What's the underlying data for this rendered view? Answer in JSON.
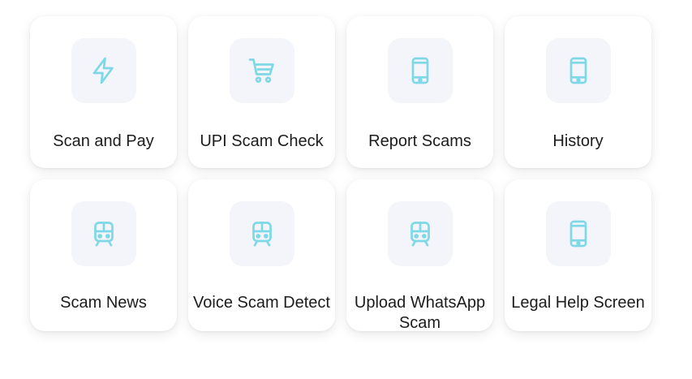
{
  "accent_color": "#7fd8e6",
  "tile_background": "#f4f5fb",
  "cards": [
    {
      "label": "Scan and Pay",
      "icon": "lightning-icon"
    },
    {
      "label": "UPI Scam Check",
      "icon": "shopping-cart-icon"
    },
    {
      "label": "Report Scams",
      "icon": "smartphone-icon"
    },
    {
      "label": "History",
      "icon": "smartphone-icon"
    },
    {
      "label": "Scam News",
      "icon": "train-icon"
    },
    {
      "label": "Voice Scam Detect",
      "icon": "train-icon"
    },
    {
      "label": "Upload WhatsApp Scam",
      "icon": "train-icon"
    },
    {
      "label": "Legal Help Screen",
      "icon": "smartphone-icon"
    }
  ]
}
